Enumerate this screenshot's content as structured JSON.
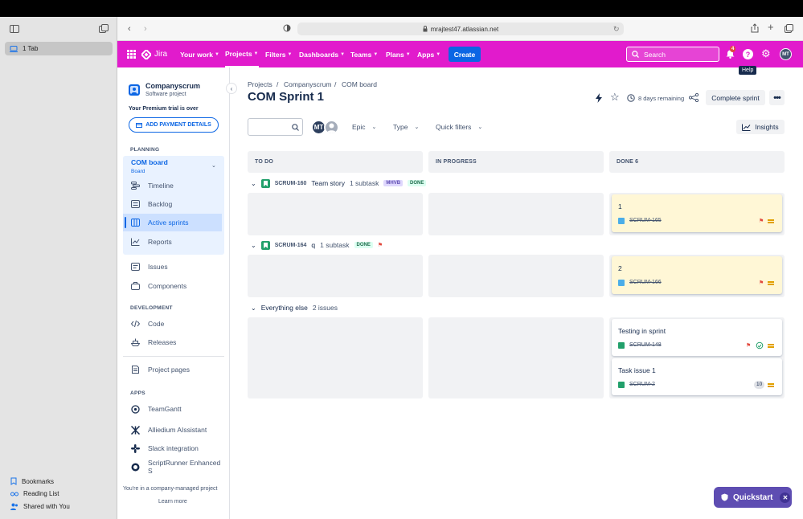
{
  "safari": {
    "tab_label": "1 Tab",
    "url": "mrajtest47.atlassian.net",
    "bookmarks": "Bookmarks",
    "reading_list": "Reading List",
    "shared": "Shared with You"
  },
  "nav": {
    "logo": "Jira",
    "your_work": "Your work",
    "projects": "Projects",
    "filters": "Filters",
    "dashboards": "Dashboards",
    "teams": "Teams",
    "plans": "Plans",
    "apps": "Apps",
    "create": "Create",
    "search_placeholder": "Search",
    "notification_count": "4",
    "help_tooltip": "Help",
    "avatar": "MT",
    "brand_color": "#e11bcc"
  },
  "sidebar": {
    "project_name": "Companyscrum",
    "project_type": "Software project",
    "trial": "Your Premium trial is over",
    "add_payment": "ADD PAYMENT DETAILS",
    "planning": "PLANNING",
    "board_name": "COM board",
    "board_sub": "Board",
    "timeline": "Timeline",
    "backlog": "Backlog",
    "active_sprints": "Active sprints",
    "reports": "Reports",
    "issues": "Issues",
    "components": "Components",
    "development": "DEVELOPMENT",
    "code": "Code",
    "releases": "Releases",
    "project_pages": "Project pages",
    "apps": "APPS",
    "teamgantt": "TeamGantt",
    "alliedium": "Alliedium AIssistant",
    "slack": "Slack integration",
    "scriptrunner": "ScriptRunner Enhanced S",
    "company_managed": "You're in a company-managed project",
    "learn_more": "Learn more"
  },
  "board": {
    "breadcrumb": [
      "Projects",
      "Companyscrum",
      "COM board"
    ],
    "title": "COM Sprint 1",
    "days_remaining": "8 days remaining",
    "complete_sprint": "Complete sprint",
    "avatar": "MT",
    "epic": "Epic",
    "type": "Type",
    "quick_filters": "Quick filters",
    "insights": "Insights",
    "columns": [
      "TO DO",
      "IN PROGRESS",
      "DONE 6"
    ],
    "swimlanes": [
      {
        "key": "SCRUM-160",
        "summary": "Team story",
        "subtasks": "1 subtask",
        "label": "MHVB",
        "status": "DONE"
      },
      {
        "key": "SCRUM-164",
        "summary": "q",
        "subtasks": "1 subtask",
        "status": "DONE"
      }
    ],
    "everything_else": "Everything else",
    "everything_else_count": "2 issues",
    "cards": [
      {
        "title": "1",
        "key": "SCRUM-165"
      },
      {
        "title": "2",
        "key": "SCRUM-166"
      },
      {
        "title": "Testing in sprint",
        "key": "SCRUM-148"
      },
      {
        "title": "Task issue 1",
        "key": "SCRUM-2",
        "estimate": "10"
      }
    ]
  },
  "quickstart": "Quickstart"
}
